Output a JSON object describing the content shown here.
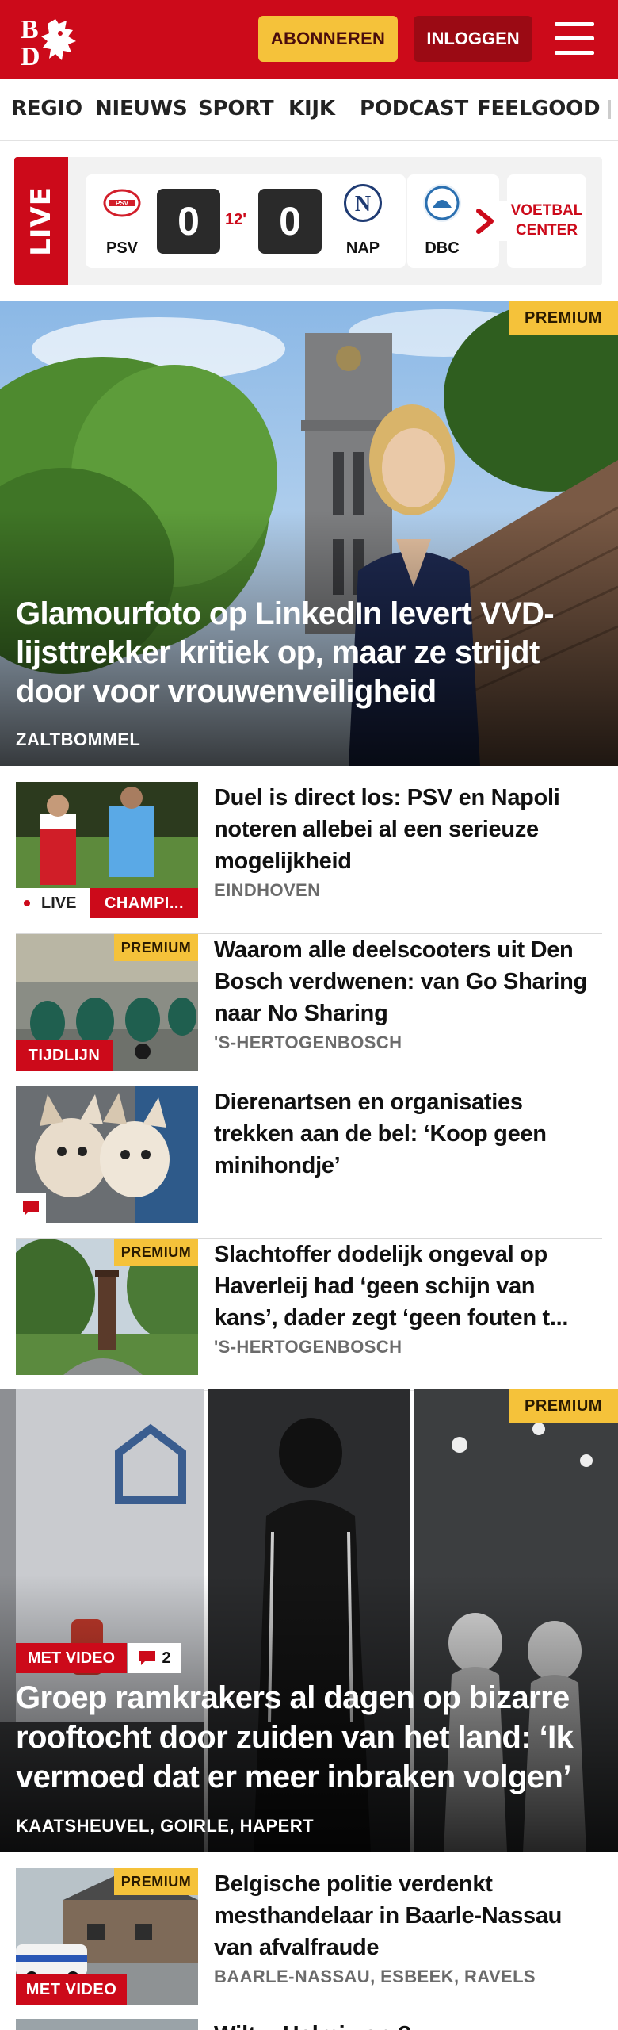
{
  "header": {
    "logo_text": "BD",
    "subscribe_label": "ABONNEREN",
    "login_label": "INLOGGEN",
    "brand_color": "#cc0a1a",
    "accent_color": "#f5c23a",
    "menu_icon": "hamburger-icon"
  },
  "nav": {
    "items": [
      "REGIO",
      "NIEUWS",
      "SPORT",
      "KIJK",
      "PODCAST",
      "FEELGOOD"
    ]
  },
  "live": {
    "label": "LIVE",
    "match": {
      "home": "PSV",
      "away": "NAP",
      "home_score": "0",
      "away_score": "0",
      "minute": "12'"
    },
    "next_team": "DBC",
    "more_icon": "chevron-right-icon",
    "center_label_1": "VOETBAL",
    "center_label_2": "CENTER"
  },
  "hero": {
    "badge": "PREMIUM",
    "title": "Glamourfoto op LinkedIn levert VVD-lijsttrekker kritiek op, maar ze strijdt door voor vrouwenveiligheid",
    "location": "ZALTBOMMEL"
  },
  "articles": [
    {
      "title": "Duel is direct los: PSV en Napoli noteren allebei al een serieuze mogelijkheid",
      "location": "EINDHOVEN",
      "live_label": "LIVE",
      "category_label": "CHAMPI..."
    },
    {
      "title": "Waarom alle deelscooters uit Den Bosch verdwenen: van Go Sharing naar No Sharing",
      "location": "'S-HERTOGENBOSCH",
      "badge": "PREMIUM",
      "tag": "TIJDLIJN"
    },
    {
      "title": "Dierenartsen en organisaties trekken aan de bel: ‘Koop geen minihondje’",
      "comment_icon": "comment-icon"
    },
    {
      "title": "Slachtoffer dodelijk ongeval op Haverleij had ‘geen schijn van kans’, dader zegt ‘geen fouten t...",
      "location": "'S-HERTOGENBOSCH",
      "badge": "PREMIUM"
    }
  ],
  "big_article": {
    "badge": "PREMIUM",
    "video_label": "MET VIDEO",
    "comment_count": "2",
    "title": "Groep ramkrakers al dagen op bizarre rooftocht door zuiden van het land: ‘Ik vermoed dat er meer inbraken volgen’",
    "location": "KAATSHEUVEL, GOIRLE, HAPERT"
  },
  "article_after": {
    "title": "Belgische politie verdenkt mesthandelaar in Baarle-Nassau van afvalfraude",
    "location": "BAARLE-NASSAU, ESBEEK, RAVELS",
    "badge": "PREMIUM",
    "video_label": "MET VIDEO"
  },
  "peek": {
    "title": "Wilt u Helmi van ?"
  }
}
